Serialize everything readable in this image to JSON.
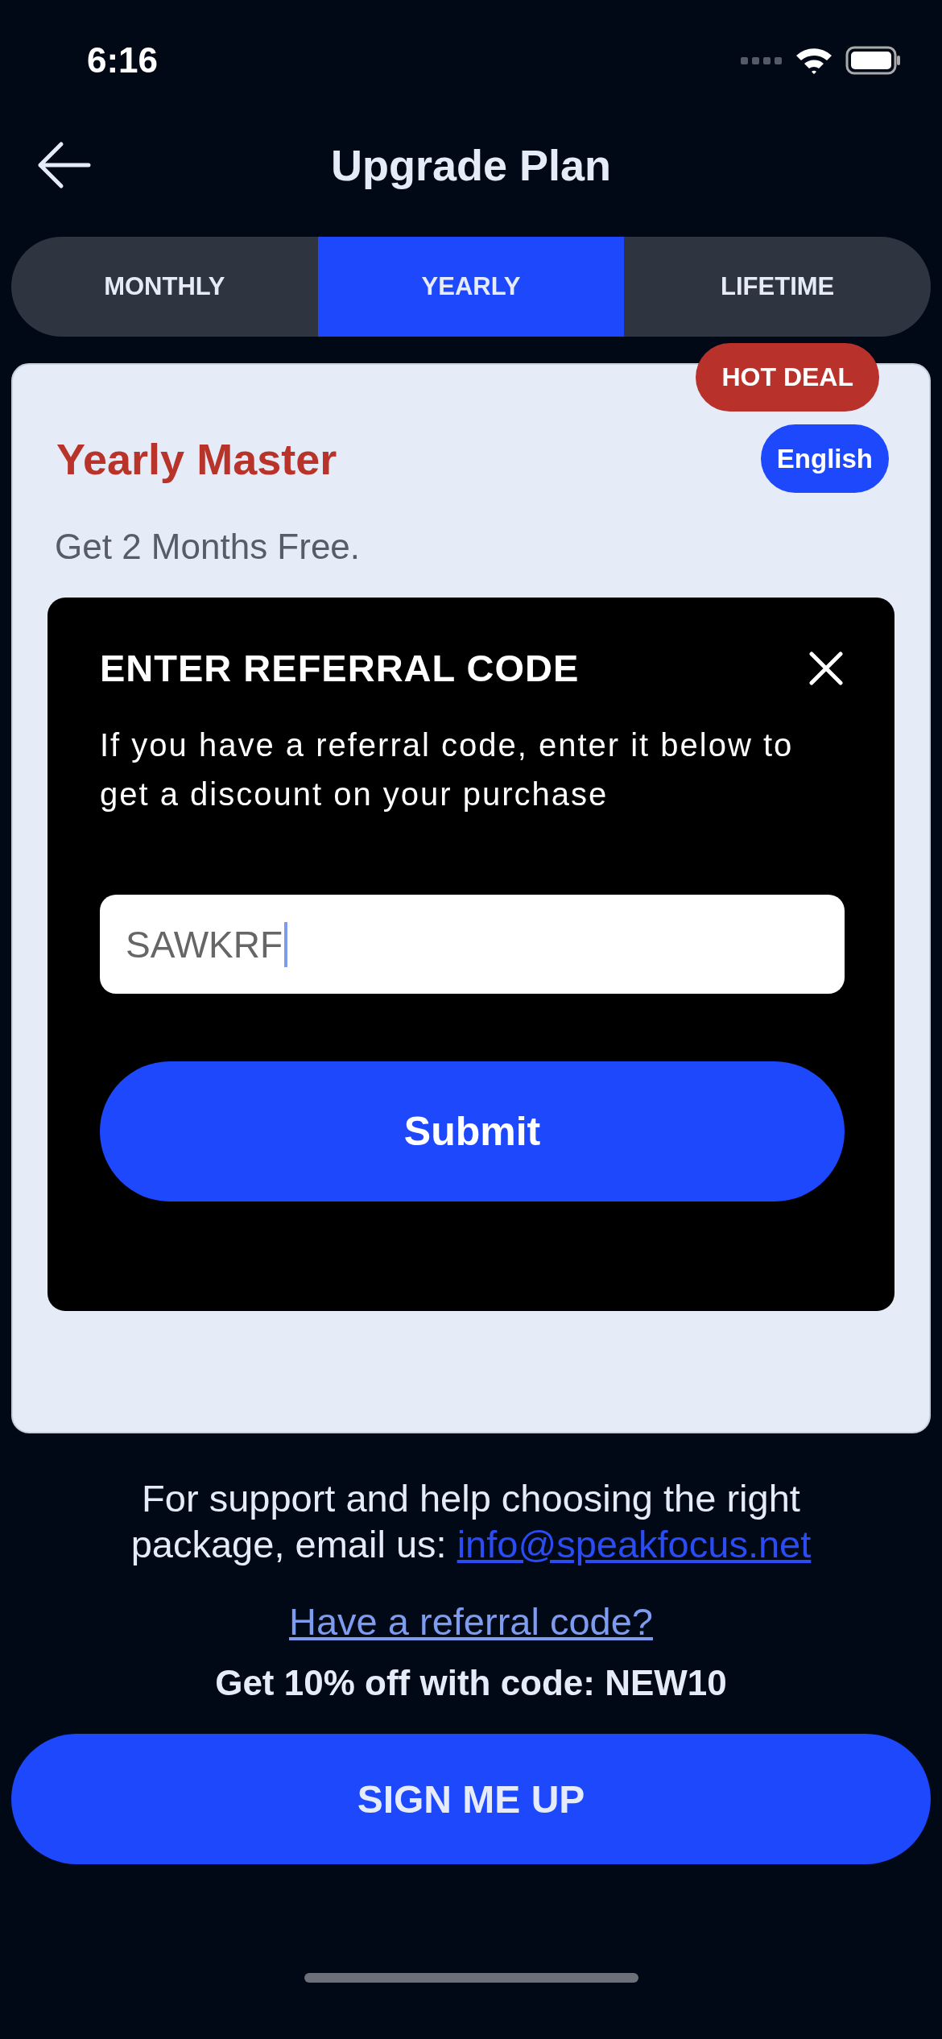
{
  "status_bar": {
    "time": "6:16"
  },
  "header": {
    "title": "Upgrade Plan"
  },
  "tabs": [
    {
      "label": "MONTHLY",
      "selected": false
    },
    {
      "label": "YEARLY",
      "selected": true
    },
    {
      "label": "LIFETIME",
      "selected": false
    }
  ],
  "plan": {
    "badge": "HOT DEAL",
    "language": "English",
    "name": "Yearly Master",
    "subtitle": "Get 2 Months Free."
  },
  "modal": {
    "title": "ENTER REFERRAL CODE",
    "description": "If you have a referral code, enter it below to get a discount on your purchase",
    "input": {
      "value": "SAWKRF"
    },
    "button": "Submit"
  },
  "support": {
    "text": "For support and help choosing the right package, email us:",
    "email": "info@speakfocus.net"
  },
  "referral_link": "Have a referral code?",
  "promo": "Get 10% off with code: NEW10",
  "signup_button": "SIGN ME UP"
}
